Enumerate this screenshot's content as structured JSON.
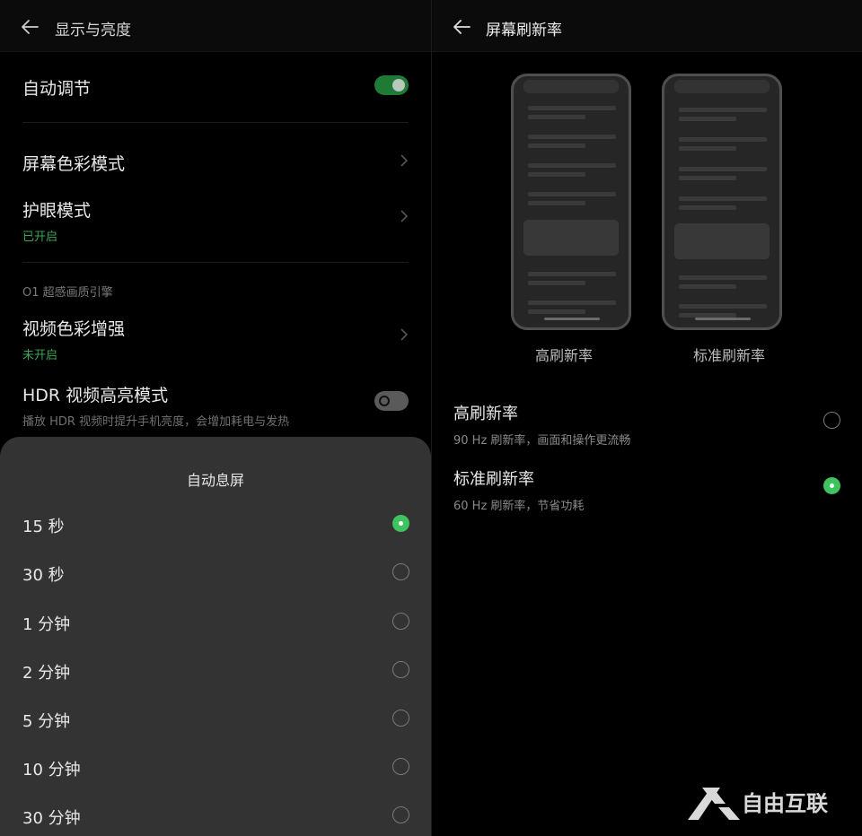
{
  "left": {
    "header": {
      "title": "显示与亮度"
    },
    "auto_adjust": {
      "label": "自动调节",
      "enabled": true
    },
    "color_mode": {
      "label": "屏幕色彩模式"
    },
    "eye_care": {
      "label": "护眼模式",
      "status": "已开启"
    },
    "section_label": "O1 超感画质引擎",
    "video_enhance": {
      "label": "视频色彩增强",
      "status": "未开启"
    },
    "hdr_mode": {
      "label": "HDR 视频高亮模式",
      "desc": "播放 HDR 视频时提升手机亮度，会增加耗电与发热",
      "enabled": false
    },
    "sheet": {
      "title": "自动息屏",
      "selected_index": 0,
      "options": [
        "15 秒",
        "30 秒",
        "1 分钟",
        "2 分钟",
        "5 分钟",
        "10 分钟",
        "30 分钟"
      ]
    }
  },
  "right": {
    "header": {
      "title": "屏幕刷新率"
    },
    "preview_captions": [
      "高刷新率",
      "标准刷新率"
    ],
    "options": [
      {
        "label": "高刷新率",
        "desc": "90 Hz 刷新率，画面和操作更流畅",
        "selected": false
      },
      {
        "label": "标准刷新率",
        "desc": "60 Hz 刷新率，节省功耗",
        "selected": true
      }
    ]
  },
  "watermark": {
    "text": "自由互联"
  },
  "colors": {
    "accent_green": "#3ec45e",
    "toggle_on": "#1f7a36",
    "sheet_bg": "#333333",
    "bg": "#000000"
  }
}
